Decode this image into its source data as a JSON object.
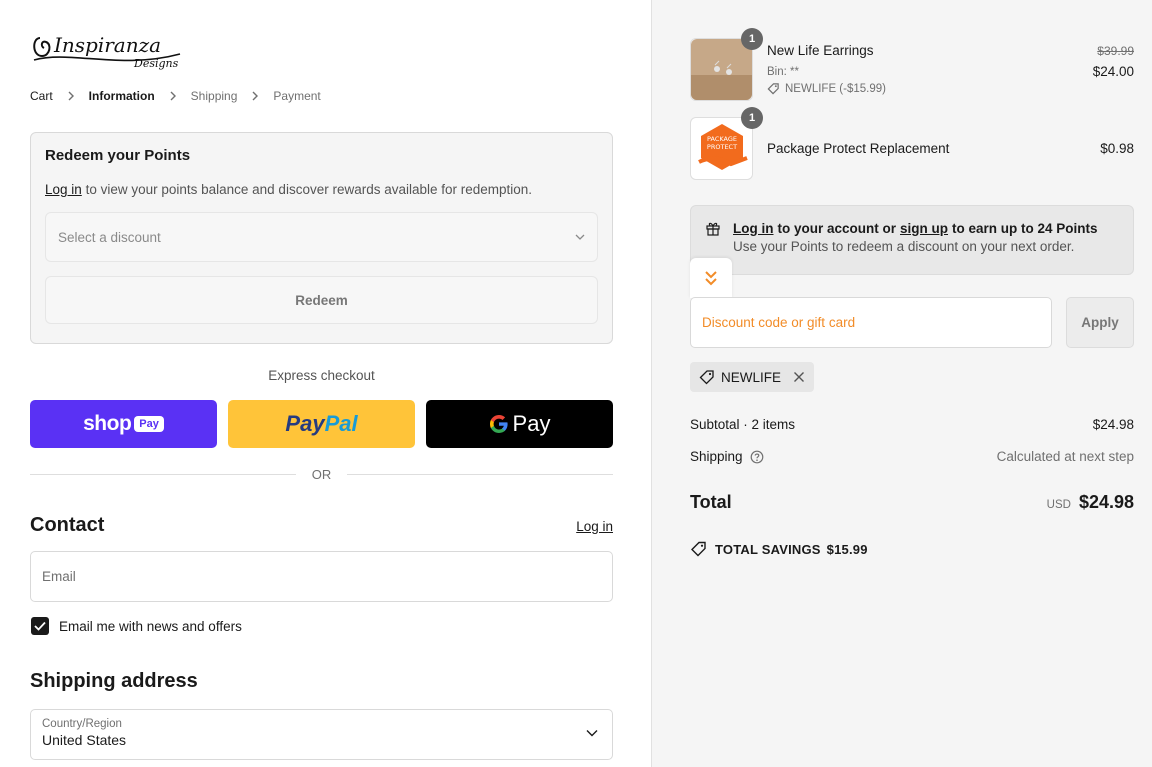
{
  "brand": {
    "logo_text": "Inspiranza",
    "logo_sub": "Designs"
  },
  "breadcrumb": [
    {
      "label": "Cart",
      "state": "link"
    },
    {
      "label": "Information",
      "state": "active"
    },
    {
      "label": "Shipping",
      "state": "inactive"
    },
    {
      "label": "Payment",
      "state": "inactive"
    }
  ],
  "points": {
    "title": "Redeem your Points",
    "login_link": "Log in",
    "description": "to view your points balance and discover rewards available for redemption.",
    "select_placeholder": "Select a discount",
    "redeem_label": "Redeem"
  },
  "express": {
    "label": "Express checkout",
    "shop_text": "shop",
    "shop_badge": "Pay",
    "paypal_1": "Pay",
    "paypal_2": "Pal",
    "gpay_text": "Pay",
    "or_label": "OR"
  },
  "contact": {
    "title": "Contact",
    "login_label": "Log in",
    "email_placeholder": "Email",
    "newsletter_label": "Email me with news and offers",
    "newsletter_checked": true
  },
  "shipping": {
    "title": "Shipping address",
    "country_label": "Country/Region",
    "country_value": "United States"
  },
  "order": {
    "items": [
      {
        "name": "New Life Earrings",
        "quantity": "1",
        "variant": "Bin: **",
        "discount": "NEWLIFE (-$15.99)",
        "original_price": "$39.99",
        "price": "$24.00"
      },
      {
        "name": "Package Protect Replacement",
        "quantity": "1",
        "thumb_text_1": "PACKAGE",
        "thumb_text_2": "PROTECT",
        "price": "$0.98"
      }
    ],
    "earn": {
      "login_link": "Log in",
      "middle": "to your account or",
      "signup_link": "sign up",
      "tail": "to earn up to 24 Points",
      "line2": "Use your Points to redeem a discount on your next order."
    },
    "discount_placeholder": "Discount code or gift card",
    "apply_label": "Apply",
    "applied_code": "NEWLIFE",
    "subtotal_label": "Subtotal · 2 items",
    "subtotal_value": "$24.98",
    "shipping_label": "Shipping",
    "shipping_value": "Calculated at next step",
    "total_label": "Total",
    "total_currency": "USD",
    "total_value": "$24.98",
    "savings_label": "TOTAL SAVINGS",
    "savings_value": "$15.99"
  },
  "colors": {
    "shop_pay": "#5a31f4",
    "paypal": "#ffc439",
    "gpay": "#000000",
    "accent_orange": "#f28c28"
  }
}
